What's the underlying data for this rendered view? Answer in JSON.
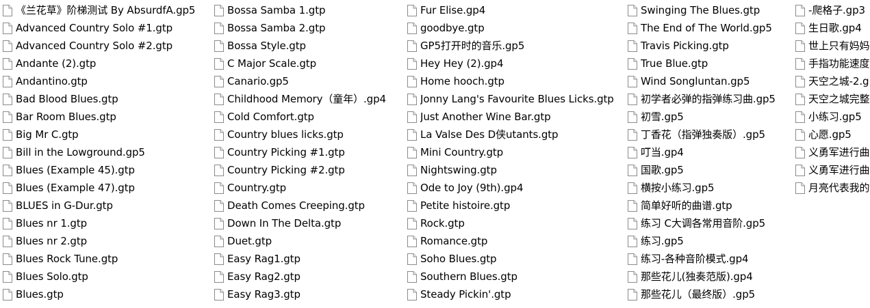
{
  "icon": "blank-document-icon",
  "colors": {
    "icon_stroke": "#8a8a8a",
    "icon_fill": "#ffffff",
    "text": "#000000"
  },
  "columns": [
    [
      "《兰花草》阶梯测试 By AbsurdfA.gp5",
      "Advanced Country Solo #1.gtp",
      "Advanced Country Solo #2.gtp",
      "Andante (2).gtp",
      "Andantino.gtp",
      "Bad Blood Blues.gtp",
      "Bar Room Blues.gtp",
      "Big Mr C.gtp",
      "Bill in the Lowground.gp5",
      "Blues (Example 45).gtp",
      "Blues (Example 47).gtp",
      "BLUES in G-Dur.gtp",
      "Blues nr 1.gtp",
      "Blues nr 2.gtp",
      "Blues Rock Tune.gtp",
      "Blues Solo.gtp",
      "Blues.gtp"
    ],
    [
      "Bossa Samba 1.gtp",
      "Bossa Samba 2.gtp",
      "Bossa Style.gtp",
      "C Major Scale.gtp",
      "Canario.gp5",
      "Childhood Memory（童年）.gp4",
      "Cold Comfort.gtp",
      "Country blues licks.gtp",
      "Country Picking #1.gtp",
      "Country Picking #2.gtp",
      "Country.gtp",
      "Death Comes Creeping.gtp",
      "Down In The Delta.gtp",
      "Duet.gtp",
      "Easy Rag1.gtp",
      "Easy Rag2.gtp",
      "Easy Rag3.gtp"
    ],
    [
      "Fur Elise.gp4",
      "goodbye.gtp",
      "GP5打开时的音乐.gp5",
      "Hey Hey (2).gp4",
      "Home hooch.gtp",
      "Jonny Lang's Favourite Blues Licks.gtp",
      "Just Another Wine Bar.gtp",
      "La Valse Des D侠utants.gtp",
      "Mini Country.gtp",
      "Nightswing.gtp",
      "Ode to Joy (9th).gp4",
      "Petite histoire.gtp",
      "Rock.gtp",
      "Romance.gtp",
      "Soho Blues.gtp",
      "Southern Blues.gtp",
      "Steady Pickin'.gtp"
    ],
    [
      "Swinging The Blues.gtp",
      "The End of The World.gp5",
      "Travis Picking.gtp",
      "True Blue.gtp",
      "Wind Songluntan.gp5",
      "初学者必弹的指弹练习曲.gp5",
      "初雪.gp5",
      "丁香花（指弹独奏版）.gp5",
      "叮当.gp4",
      "国歌.gp5",
      "横按小练习.gp5",
      "简单好听的曲谱.gtp",
      "练习 C大调各常用音阶.gp5",
      "练习.gp5",
      "练习-各种音阶模式.gp4",
      "那些花儿(独奏范版).gp4",
      "那些花儿（最终版）.gp5"
    ],
    [
      "-爬格子.gp3",
      "生日歌.gp4",
      "世上只有妈妈",
      "手指功能速度",
      "天空之城-2.g",
      "天空之城完整",
      "小练习.gp5",
      "心愿.gp5",
      "义勇军进行曲",
      "义勇军进行曲",
      "月亮代表我的"
    ]
  ]
}
